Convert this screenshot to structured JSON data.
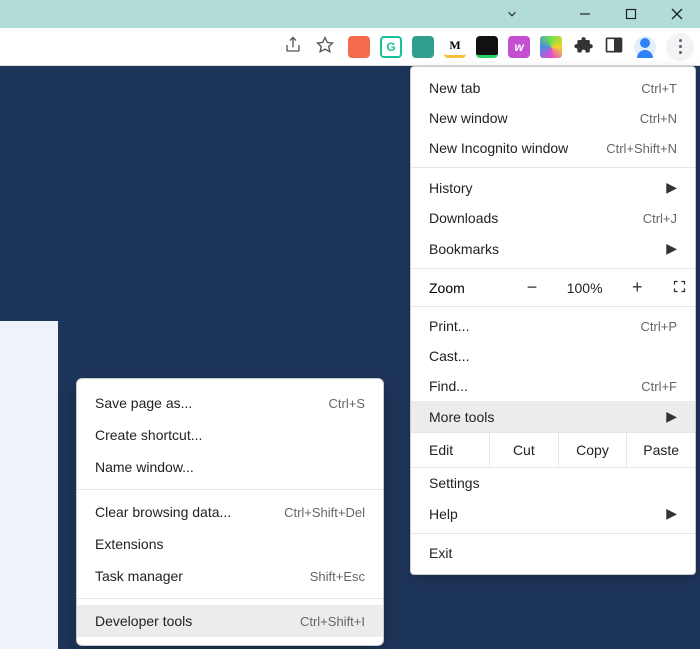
{
  "window_controls": {
    "minimize_icon": "minimize",
    "maximize_icon": "maximize",
    "close_icon": "close",
    "chevron_icon": "chevron-down"
  },
  "toolbar_icons": {
    "share_icon": "share",
    "star_icon": "bookmark-star",
    "puzzle_icon": "extensions",
    "side_panel_icon": "side-panel",
    "profile_icon": "profile",
    "kebab_icon": "customize-chrome"
  },
  "extensions": [
    {
      "name": "ext-red",
      "bg": "#f36b4a"
    },
    {
      "name": "ext-grammarly",
      "bg": "#15c39a",
      "letter": "G"
    },
    {
      "name": "ext-teal",
      "bg": "#2fa08f"
    },
    {
      "name": "ext-m",
      "bg": "#ffffff",
      "letter": "M",
      "color": "#000",
      "underline": "#f3c13a"
    },
    {
      "name": "ext-black",
      "bg": "#111",
      "underline": "#25d366"
    },
    {
      "name": "ext-w",
      "bg": "#c44fd1",
      "letter": "w",
      "italic": true
    },
    {
      "name": "ext-diamond",
      "bg": "linear-gradient(135deg,#6ee34a,#f5d22a,#e34ad1,#4a8be3)"
    }
  ],
  "menu": {
    "new_tab": {
      "label": "New tab",
      "shortcut": "Ctrl+T"
    },
    "new_window": {
      "label": "New window",
      "shortcut": "Ctrl+N"
    },
    "new_incognito": {
      "label": "New Incognito window",
      "shortcut": "Ctrl+Shift+N"
    },
    "history": {
      "label": "History"
    },
    "downloads": {
      "label": "Downloads",
      "shortcut": "Ctrl+J"
    },
    "bookmarks": {
      "label": "Bookmarks"
    },
    "zoom": {
      "label": "Zoom",
      "minus": "−",
      "pct": "100%",
      "plus": "+"
    },
    "print": {
      "label": "Print...",
      "shortcut": "Ctrl+P"
    },
    "cast": {
      "label": "Cast..."
    },
    "find": {
      "label": "Find...",
      "shortcut": "Ctrl+F"
    },
    "more_tools": {
      "label": "More tools"
    },
    "edit": {
      "label": "Edit",
      "cut": "Cut",
      "copy": "Copy",
      "paste": "Paste"
    },
    "settings": {
      "label": "Settings"
    },
    "help": {
      "label": "Help"
    },
    "exit": {
      "label": "Exit"
    }
  },
  "submenu": {
    "save_page": {
      "label": "Save page as...",
      "shortcut": "Ctrl+S"
    },
    "create_shortcut": {
      "label": "Create shortcut..."
    },
    "name_window": {
      "label": "Name window..."
    },
    "clear_browsing": {
      "label": "Clear browsing data...",
      "shortcut": "Ctrl+Shift+Del"
    },
    "extensions": {
      "label": "Extensions"
    },
    "task_manager": {
      "label": "Task manager",
      "shortcut": "Shift+Esc"
    },
    "developer_tools": {
      "label": "Developer tools",
      "shortcut": "Ctrl+Shift+I"
    }
  },
  "colors": {
    "titlebar": "#b2dcd7",
    "page_bg": "#1e355a"
  }
}
